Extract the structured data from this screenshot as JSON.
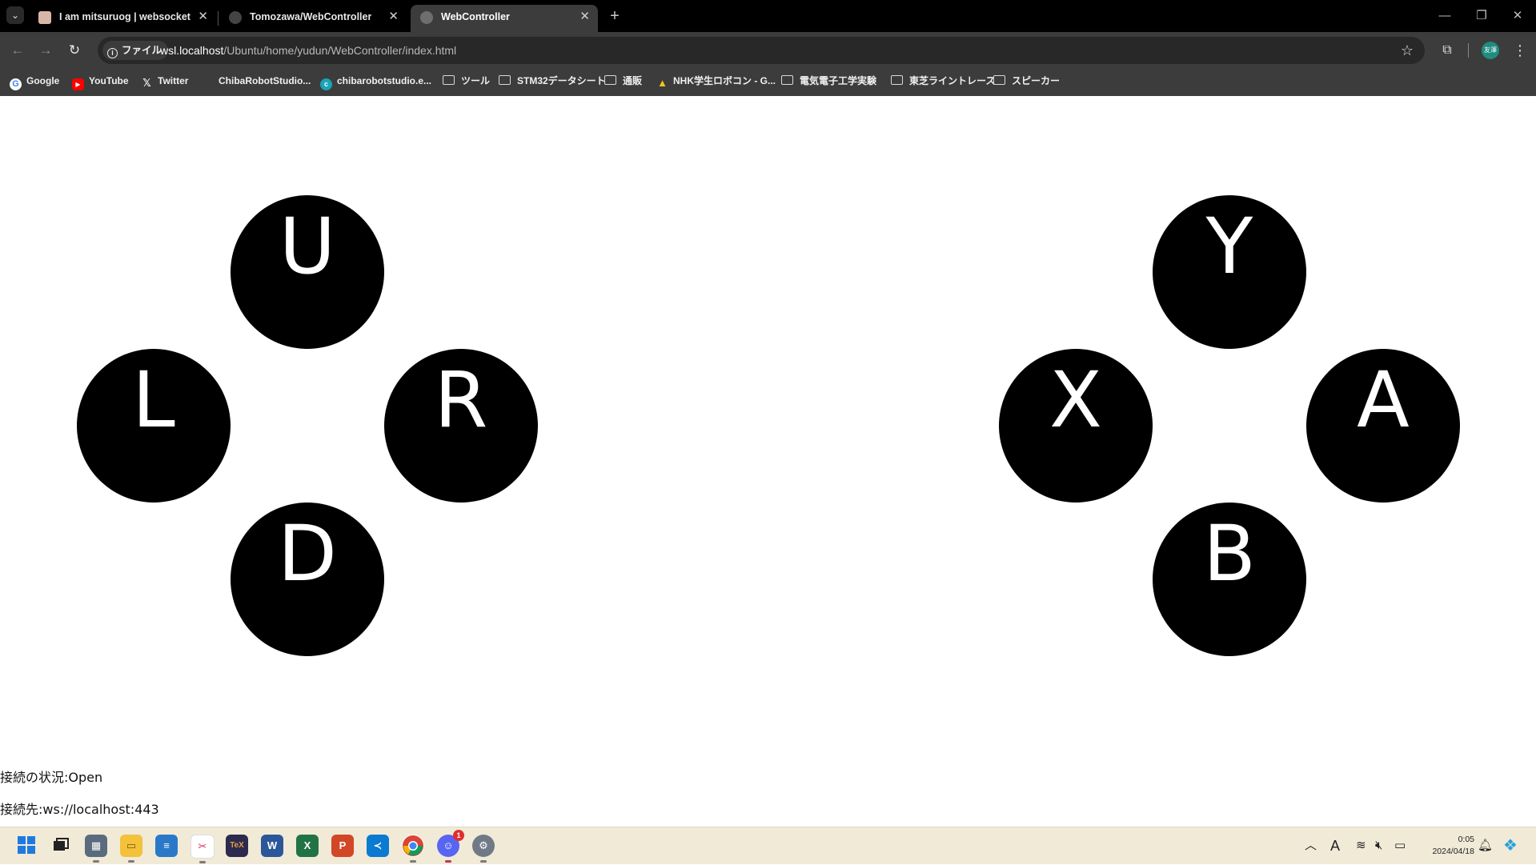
{
  "browser": {
    "tabs": [
      {
        "title": "I am mitsuruog | websocketを",
        "active": false
      },
      {
        "title": "Tomozawa/WebController",
        "active": false
      },
      {
        "title": "WebController",
        "active": true
      }
    ],
    "tab_close_glyph": "✕",
    "new_tab_glyph": "+",
    "window_controls": {
      "minimize": "—",
      "restore": "❐",
      "close": "✕"
    },
    "nav": {
      "back": "←",
      "forward": "→",
      "reload": "↻"
    },
    "omnibox": {
      "site_chip_label": "ファイル",
      "url_host": "wsl.localhost",
      "url_path": "/Ubuntu/home/yudun/WebController/index.html"
    },
    "profile_label": "友澤"
  },
  "bookmarks": [
    {
      "label": "Google",
      "icon": "google-icon"
    },
    {
      "label": "YouTube",
      "icon": "youtube-icon"
    },
    {
      "label": "Twitter",
      "icon": "x-icon"
    },
    {
      "label": "ChibaRobotStudio...",
      "icon": "blank-icon"
    },
    {
      "label": "chibarobotstudio.e...",
      "icon": "site-icon"
    },
    {
      "label": "ツール",
      "icon": "folder-icon"
    },
    {
      "label": "STM32データシート",
      "icon": "folder-icon"
    },
    {
      "label": "通販",
      "icon": "folder-icon"
    },
    {
      "label": "NHK学生ロボコン - G...",
      "icon": "drive-icon"
    },
    {
      "label": "電気電子工学実験",
      "icon": "folder-icon"
    },
    {
      "label": "東芝ライントレース",
      "icon": "folder-icon"
    },
    {
      "label": "スピーカー",
      "icon": "folder-icon"
    }
  ],
  "controller": {
    "dpad": {
      "up": "U",
      "left": "L",
      "right": "R",
      "down": "D"
    },
    "face": {
      "top": "Y",
      "left": "X",
      "right": "A",
      "bottom": "B"
    }
  },
  "status": {
    "connection": "接続の状況:Open",
    "endpoint": "接続先:ws://localhost:443"
  },
  "taskbar": {
    "apps": [
      "start",
      "task-view",
      "calculator",
      "file-explorer",
      "notepad",
      "snipping-tool",
      "texworks",
      "word",
      "excel",
      "powerpoint",
      "vscode",
      "chrome",
      "discord",
      "settings"
    ],
    "discord_badge": "1",
    "clock_time": "0:05",
    "clock_date": "2024/04/18",
    "ime_label": "A"
  },
  "colors": {
    "tabstrip": "#000000",
    "toolbar": "#3c3c3c",
    "button_fill": "#000000",
    "button_text": "#ffffff",
    "taskbar": "#f0ead7"
  }
}
